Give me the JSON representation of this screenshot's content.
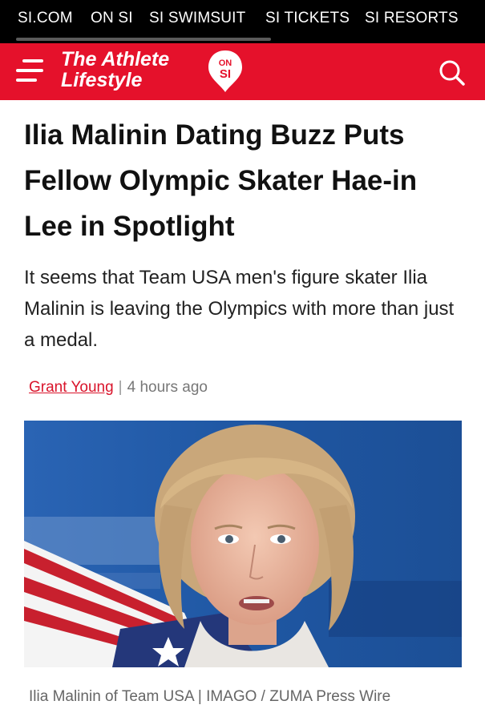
{
  "top_nav": {
    "items": [
      "SI.COM",
      "ON SI",
      "SI SWIMSUIT",
      "SI TICKETS",
      "SI RESORTS"
    ]
  },
  "header": {
    "brand_line1": "The Athlete",
    "brand_line2": "Lifestyle",
    "badge_line1": "ON",
    "badge_line2": "SI",
    "colors": {
      "brand_red": "#e5112b",
      "nav_black": "#000000"
    },
    "menu_icon": "hamburger-menu-icon",
    "search_icon": "search-icon"
  },
  "article": {
    "headline": "Ilia Malinin Dating Buzz Puts Fellow Olympic Skater Hae-in Lee in Spotlight",
    "dek": "It seems that Team USA men's figure skater Ilia Malinin is leaving the Olympics with more than just a medal.",
    "author": "Grant Young",
    "separator": "|",
    "time_ago": "4 hours ago",
    "photo_caption": "Ilia Malinin of Team USA | IMAGO / ZUMA Press Wire"
  }
}
